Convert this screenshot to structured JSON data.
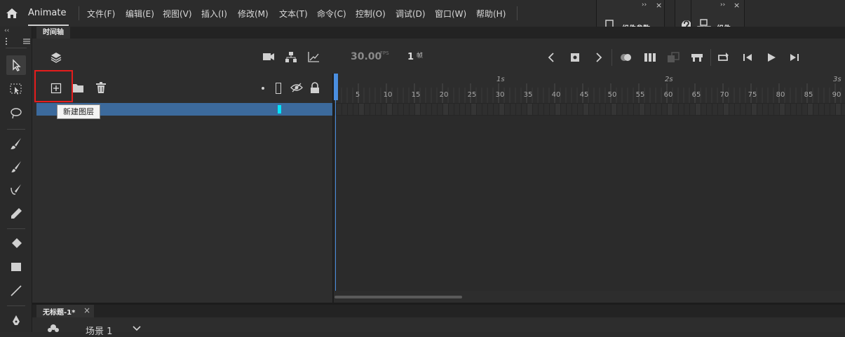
{
  "app": {
    "name": "Animate"
  },
  "menu": [
    {
      "label": "文件(F)"
    },
    {
      "label": "编辑(E)"
    },
    {
      "label": "视图(V)"
    },
    {
      "label": "插入(I)"
    },
    {
      "label": "修改(M)"
    },
    {
      "label": "文本(T)"
    },
    {
      "label": "命令(C)"
    },
    {
      "label": "控制(O)"
    },
    {
      "label": "调试(D)"
    },
    {
      "label": "窗口(W)"
    },
    {
      "label": "帮助(H)"
    }
  ],
  "panels": {
    "component_params": "组件参数",
    "components": "组件",
    "expand": "››",
    "close": "×"
  },
  "timeline": {
    "tab": "时间轴",
    "fps_value": "30.00",
    "fps_unit": "FPS",
    "frame_value": "1",
    "frame_unit": "帧",
    "tooltip": "新建图层",
    "seconds": [
      "1s",
      "2s",
      "3s"
    ],
    "ticks": [
      "5",
      "10",
      "15",
      "20",
      "25",
      "30",
      "35",
      "40",
      "45",
      "50",
      "55",
      "60",
      "65",
      "70",
      "75",
      "80",
      "85",
      "90"
    ],
    "layer_color": "#00e5ff",
    "selected_row_color": "#3c6a9c"
  },
  "document": {
    "tab": "无标题-1*",
    "close": "×",
    "scene": "场景 1"
  },
  "annotation_color": "#e51c1c"
}
